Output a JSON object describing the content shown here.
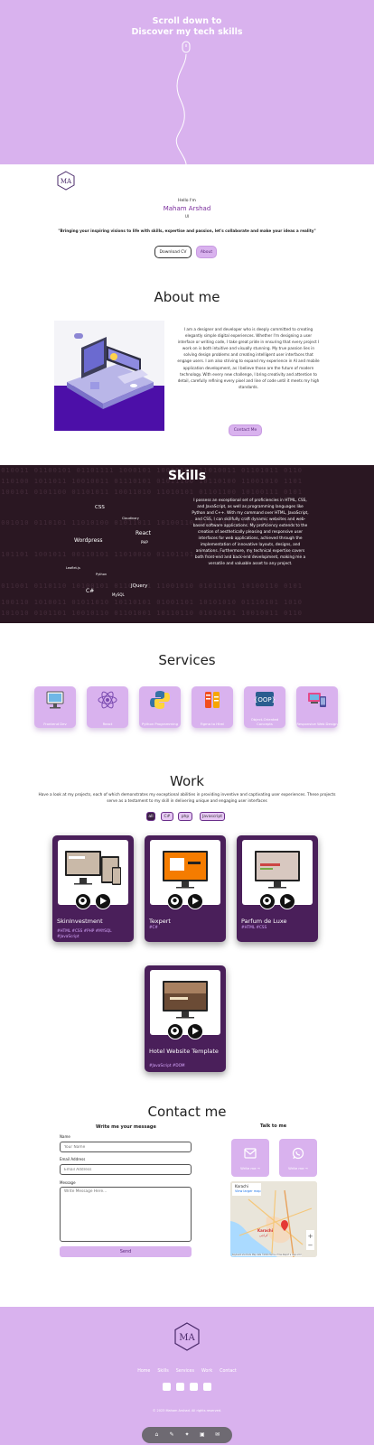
{
  "hero": {
    "line1": "Scroll down to",
    "line2": "Discover my tech skills"
  },
  "intro": {
    "hello": "Hello I'm",
    "name": "Maham Arshad",
    "role": "UI",
    "tagline": "\"Bringing your inspiring visions to life with skills, expertise and passion, let's collaborate and make your ideas a reality\"",
    "download_cv": "Download CV",
    "about_button": "About"
  },
  "about": {
    "title": "About me",
    "text": "I am a designer and developer who is deeply committed to creating elegantly simple digital experiences. Whether I'm designing a user interface or writing code, I take great pride in ensuring that every project I work on is both intuitive and visually stunning. My true passion lies in solving design problems and creating intelligent user interfaces that engage users. I am also striving to expand my experience in AI and mobile application development, as I believe those are the future of modern technology. With every new challenge, I bring creativity and attention to detail, carefully refining every pixel and line of code until it meets my high standards.",
    "contact_button": "Contact Me"
  },
  "skills": {
    "title": "Skills",
    "text": "I possess an exceptional set of proficiencies in HTML, CSS, and JavaScript, as well as programming languages like Python and C++. With my command over HTML, JavaScript, and CSS, I can skillfully craft dynamic websites and web-based software applications. My proficiency extends to the creation of aesthetically pleasing and responsive user interfaces for web applications, achieved through the implementation of innovative layouts, designs, and animations. Furthermore, my technical expertise covers both front-end and back-end development, making me a versatile and valuable asset to any project.",
    "cloud": [
      {
        "word": "CSS",
        "size": 5.5
      },
      {
        "word": "Cloudinary",
        "size": 3.5
      },
      {
        "word": "React",
        "size": 6
      },
      {
        "word": "PHP",
        "size": 4
      },
      {
        "word": "Wordpress",
        "size": 6
      },
      {
        "word": "Leaflet.js",
        "size": 3.5
      },
      {
        "word": "Python",
        "size": 3.5
      },
      {
        "word": "JQuery",
        "size": 5.5
      },
      {
        "word": "C#",
        "size": 6
      },
      {
        "word": "MySQL",
        "size": 4
      }
    ]
  },
  "services": {
    "title": "Services",
    "items": [
      {
        "label": "Frontend Dev",
        "icon": "frontend-monitor-icon"
      },
      {
        "label": "React",
        "icon": "react-atom-icon"
      },
      {
        "label": "Python Programming",
        "icon": "python-icon"
      },
      {
        "label": "Figma to Html",
        "icon": "figma-html-icon"
      },
      {
        "label": "Object-Oriented Concepts",
        "icon": "oop-icon"
      },
      {
        "label": "Responsive Web Design",
        "icon": "responsive-devices-icon"
      }
    ]
  },
  "work": {
    "title": "Work",
    "description": "Have a look at my projects, each of which demonstrates my exceptional abilities in providing inventive and captivating user experiences. These projects serve as a testament to my skill in delivering unique and engaging user interfaces",
    "filters": [
      "all",
      "C#",
      "php",
      "Javascript"
    ],
    "projects": [
      {
        "title": "SkinInvestment",
        "tags": "#HTML #CSS #PHP #MYSQL #JavaScript"
      },
      {
        "title": "Texpert",
        "tags": "#C#"
      },
      {
        "title": "Parfum de Luxe",
        "tags": "#HTML #CSS"
      },
      {
        "title": "Hotel Website Template",
        "tags": "#JavaScript #DOM"
      }
    ]
  },
  "contact": {
    "title": "Contact me",
    "form_heading": "Write me your message",
    "name_label": "Name",
    "name_placeholder": "Your Name",
    "email_label": "Email Address",
    "email_placeholder": "Email Address",
    "message_label": "Message",
    "message_placeholder": "Write Message Here...",
    "send_button": "Send",
    "talk_heading": "Talk to me",
    "email_tile": "Write me →",
    "whatsapp_tile": "Write me →",
    "map_city": "Karachi",
    "map_link": "View larger map",
    "map_city_label": "Karachi",
    "map_city_native": "کراچی",
    "map_footer": "Keyboard shortcuts   Map data ©2024   Terms of Use   Report a map error"
  },
  "footer": {
    "nav": [
      "Home",
      "Skills",
      "Services",
      "Work",
      "Contact"
    ],
    "copyright": "© 2023 Maham Arshad. All rights reserved."
  },
  "colors": {
    "lavender": "#d9b2ee",
    "purple_dark": "#4a1f5a",
    "name_purple": "#7a2c9c"
  }
}
